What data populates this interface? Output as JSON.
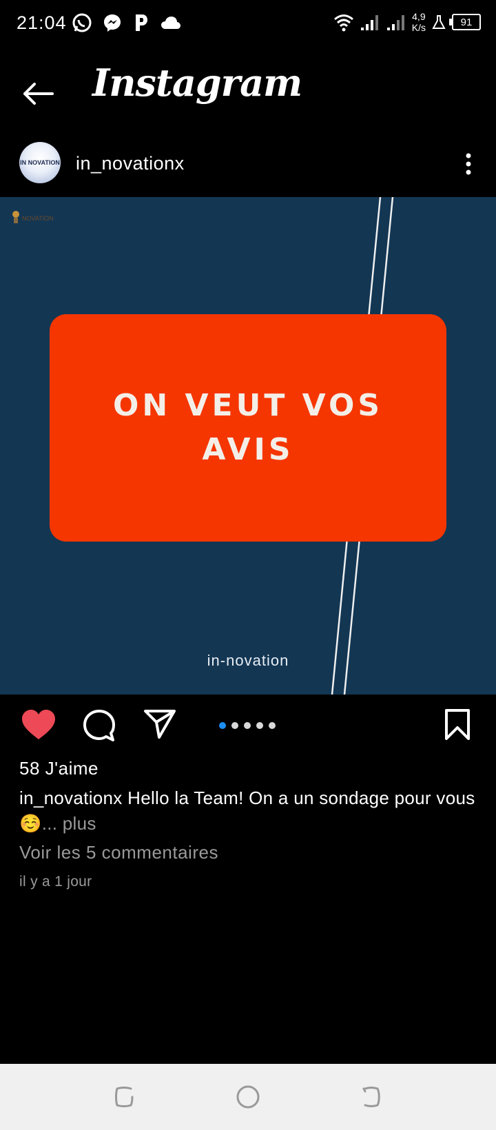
{
  "status_bar": {
    "time": "21:04",
    "left_icons": [
      "whatsapp-icon",
      "messenger-icon",
      "p-app-icon",
      "cloud-icon"
    ],
    "net_speed_value": "4,9",
    "net_speed_unit": "K/s",
    "battery": "91"
  },
  "app_bar": {
    "title": "Instagram"
  },
  "post": {
    "username": "in_novationx",
    "avatar_text": "IN NOVATION",
    "image": {
      "brand_mark": "NOVATION",
      "headline": "ON VEUT VOS AVIS",
      "footer": "in-novation",
      "background_color": "#133653",
      "card_color": "#f53600"
    },
    "carousel": {
      "count": 5,
      "active": 0
    },
    "likes": "58 J'aime",
    "caption_user": "in_novationx",
    "caption_text": " Hello la Team! On a un sondage pour vous ☺️",
    "caption_more": "... plus",
    "comments_link": "Voir les 5 commentaires",
    "timestamp": "il y a 1 jour"
  },
  "colors": {
    "like_red": "#ed4956",
    "carousel_blue": "#1d8ef5"
  }
}
